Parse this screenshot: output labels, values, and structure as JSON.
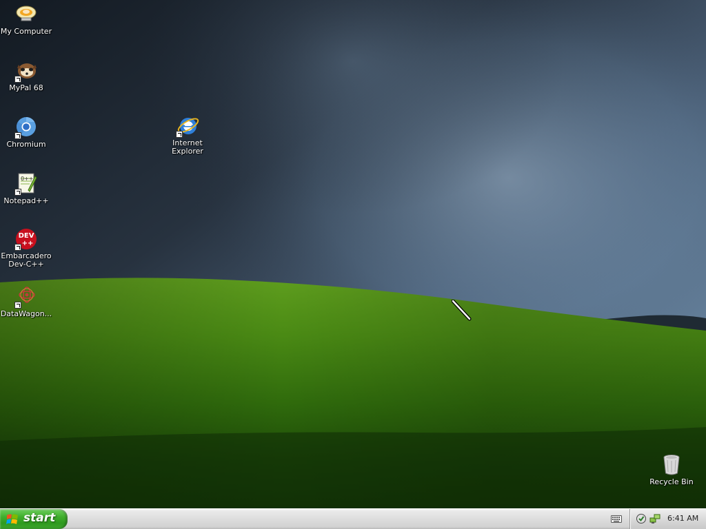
{
  "desktop": {
    "icons": [
      {
        "label": "My Computer",
        "icon": "my-computer-icon",
        "shortcut": false
      },
      {
        "label": "MyPal 68",
        "icon": "mypal-icon",
        "shortcut": true
      },
      {
        "label": "Chromium",
        "icon": "chromium-icon",
        "shortcut": true
      },
      {
        "label": "Notepad++",
        "icon": "notepadpp-icon",
        "shortcut": true
      },
      {
        "label": "Embarcadero\nDev-C++",
        "icon": "devcpp-icon",
        "shortcut": true
      },
      {
        "label": "DataWagon...",
        "icon": "datawagon-icon",
        "shortcut": true
      },
      {
        "label": "Internet\nExplorer",
        "icon": "internet-explorer-icon",
        "shortcut": true
      },
      {
        "label": "Recycle Bin",
        "icon": "recycle-bin-icon",
        "shortcut": false
      }
    ]
  },
  "taskbar": {
    "start_label": "start",
    "clock": "6:41 AM"
  },
  "colors": {
    "start_green": "#3fae2c",
    "taskbar_gray": "#dcdcdc",
    "sky_dark": "#1c2530",
    "grass_green": "#5c9a1c"
  }
}
